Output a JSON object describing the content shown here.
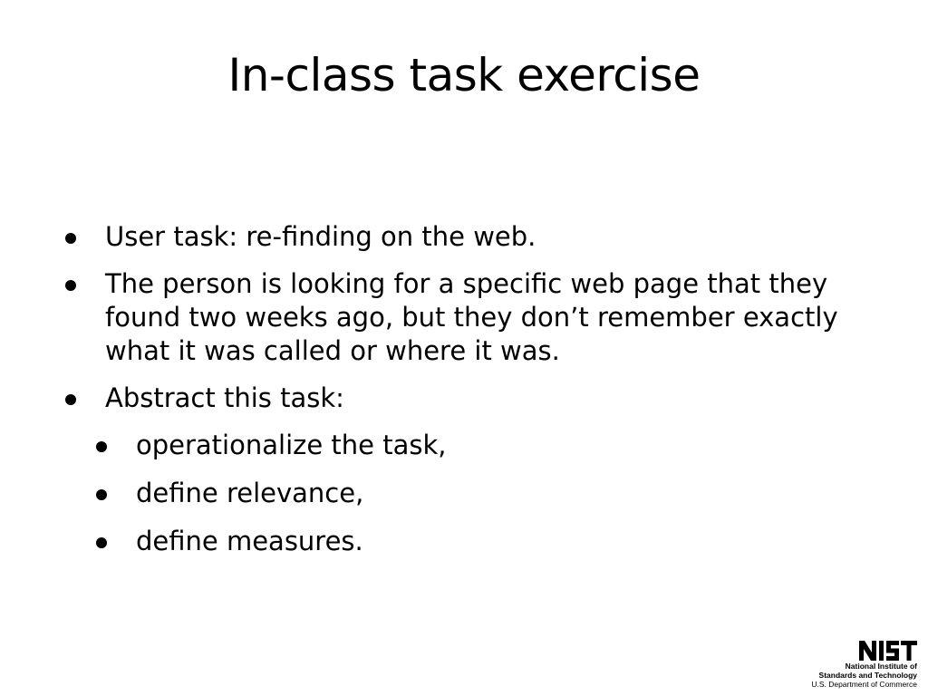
{
  "slide": {
    "title": "In-class task exercise",
    "bullets": [
      {
        "level": 1,
        "text": "User task: re-finding on the web."
      },
      {
        "level": 1,
        "text": "The person is looking for a specific web page that they found two weeks ago, but they don’t remember exactly what it was called or where it was."
      },
      {
        "level": 1,
        "text": "Abstract this task:"
      },
      {
        "level": 2,
        "text": "operationalize the task,"
      },
      {
        "level": 2,
        "text": "define relevance,"
      },
      {
        "level": 2,
        "text": "define measures."
      }
    ]
  },
  "logo": {
    "wordmark": "NIST",
    "line1": "National Institute of",
    "line2": "Standards and Technology",
    "line3": "U.S. Department of Commerce"
  }
}
